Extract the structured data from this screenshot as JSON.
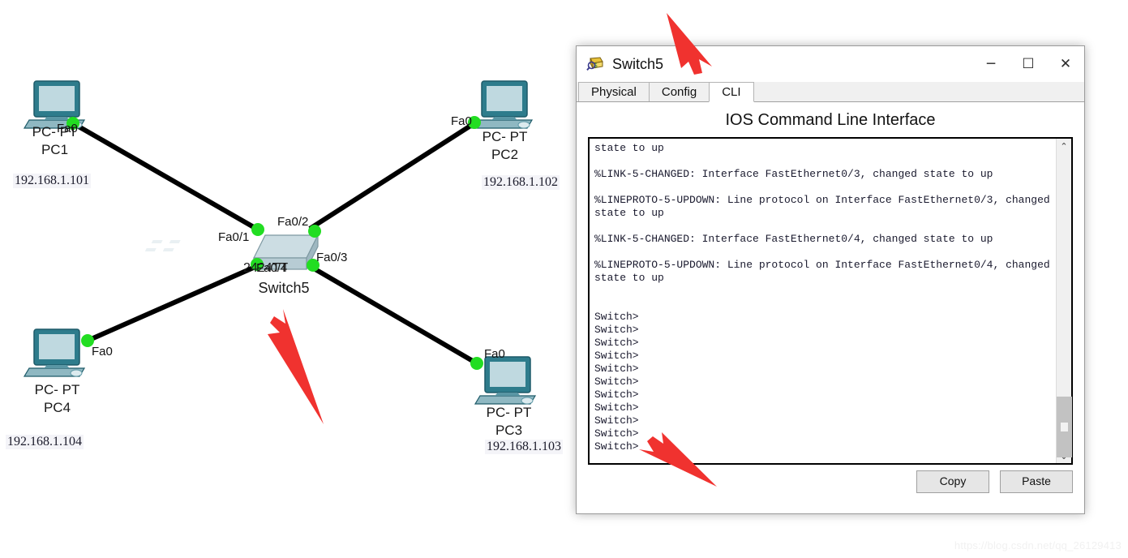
{
  "topology": {
    "nodes": [
      {
        "id": "pc1",
        "model": "PC- PT",
        "name": "PC1",
        "ip": "192.168.1.101",
        "port": "Fa0"
      },
      {
        "id": "pc2",
        "model": "PC- PT",
        "name": "PC2",
        "ip": "192.168.1.102",
        "port": "Fa0"
      },
      {
        "id": "pc3",
        "model": "PC- PT",
        "name": "PC3",
        "ip": "192.168.1.103",
        "port": "Fa0"
      },
      {
        "id": "pc4",
        "model": "PC- PT",
        "name": "PC4",
        "ip": "192.168.1.104",
        "port": "Fa0"
      }
    ],
    "switch": {
      "name": "Switch5",
      "model": "2424TT",
      "ports": [
        "Fa0/1",
        "Fa0/2",
        "Fa0/3",
        "Fa0/4"
      ]
    },
    "link_status_color": "#22dd22",
    "link_color": "#000000",
    "arrow_color": "#f0322f"
  },
  "window": {
    "title": "Switch5",
    "icon": "packet-tracer-switch-icon",
    "controls": {
      "minimize": "─",
      "maximize": "☐",
      "close": "✕"
    },
    "tabs": [
      {
        "label": "Physical",
        "active": false
      },
      {
        "label": "Config",
        "active": false
      },
      {
        "label": "CLI",
        "active": true
      }
    ],
    "panel_title": "IOS Command Line Interface",
    "terminal_lines": [
      "state to up",
      "",
      "%LINK-5-CHANGED: Interface FastEthernet0/3, changed state to up",
      "",
      "%LINEPROTO-5-UPDOWN: Line protocol on Interface FastEthernet0/3, changed",
      "state to up",
      "",
      "%LINK-5-CHANGED: Interface FastEthernet0/4, changed state to up",
      "",
      "%LINEPROTO-5-UPDOWN: Line protocol on Interface FastEthernet0/4, changed",
      "state to up",
      "",
      "",
      "Switch>",
      "Switch>",
      "Switch>",
      "Switch>",
      "Switch>",
      "Switch>",
      "Switch>",
      "Switch>",
      "Switch>",
      "Switch>",
      "Switch>"
    ],
    "scrollbar": {
      "up": "⌃",
      "down": "⌄"
    },
    "buttons": {
      "copy": "Copy",
      "paste": "Paste"
    }
  },
  "watermark": "https://blog.csdn.net/qq_26129413"
}
